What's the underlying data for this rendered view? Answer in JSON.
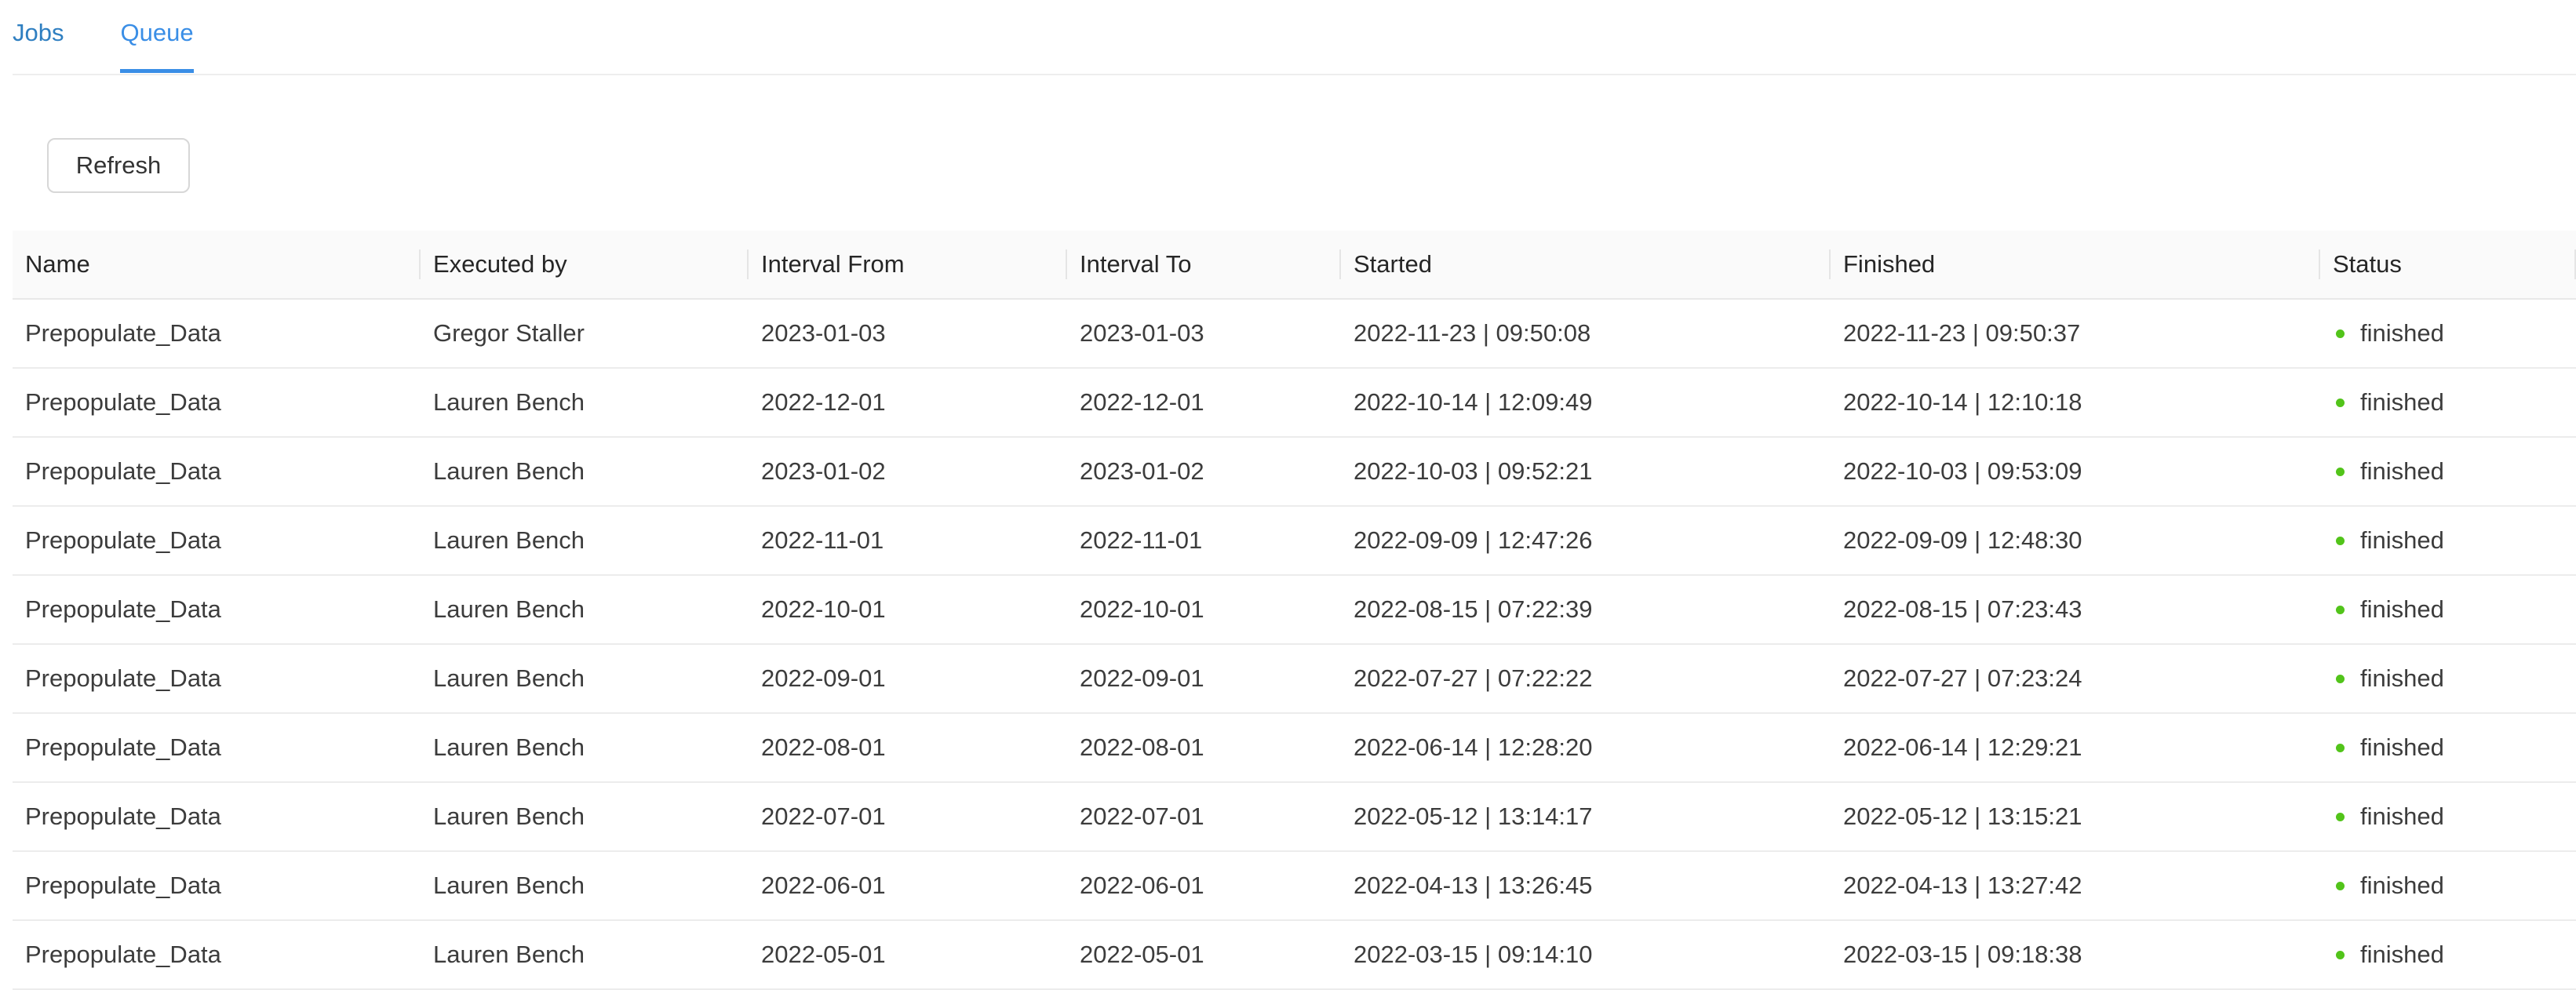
{
  "tabs": [
    {
      "label": "Jobs",
      "active": false
    },
    {
      "label": "Queue",
      "active": true
    }
  ],
  "toolbar": {
    "refresh_label": "Refresh"
  },
  "colors": {
    "accent": "#3a8ee6",
    "status_finished": "#52c41a"
  },
  "table": {
    "columns": [
      "Name",
      "Executed by",
      "Interval From",
      "Interval To",
      "Started",
      "Finished",
      "Status"
    ],
    "rows": [
      {
        "name": "Prepopulate_Data",
        "executed_by": "Gregor Staller",
        "interval_from": "2023-01-03",
        "interval_to": "2023-01-03",
        "started": "2022-11-23 | 09:50:08",
        "finished": "2022-11-23 | 09:50:37",
        "status": "finished"
      },
      {
        "name": "Prepopulate_Data",
        "executed_by": "Lauren Bench",
        "interval_from": "2022-12-01",
        "interval_to": "2022-12-01",
        "started": "2022-10-14 | 12:09:49",
        "finished": "2022-10-14 | 12:10:18",
        "status": "finished"
      },
      {
        "name": "Prepopulate_Data",
        "executed_by": "Lauren Bench",
        "interval_from": "2023-01-02",
        "interval_to": "2023-01-02",
        "started": "2022-10-03 | 09:52:21",
        "finished": "2022-10-03 | 09:53:09",
        "status": "finished"
      },
      {
        "name": "Prepopulate_Data",
        "executed_by": "Lauren Bench",
        "interval_from": "2022-11-01",
        "interval_to": "2022-11-01",
        "started": "2022-09-09 | 12:47:26",
        "finished": "2022-09-09 | 12:48:30",
        "status": "finished"
      },
      {
        "name": "Prepopulate_Data",
        "executed_by": "Lauren Bench",
        "interval_from": "2022-10-01",
        "interval_to": "2022-10-01",
        "started": "2022-08-15 | 07:22:39",
        "finished": "2022-08-15 | 07:23:43",
        "status": "finished"
      },
      {
        "name": "Prepopulate_Data",
        "executed_by": "Lauren Bench",
        "interval_from": "2022-09-01",
        "interval_to": "2022-09-01",
        "started": "2022-07-27 | 07:22:22",
        "finished": "2022-07-27 | 07:23:24",
        "status": "finished"
      },
      {
        "name": "Prepopulate_Data",
        "executed_by": "Lauren Bench",
        "interval_from": "2022-08-01",
        "interval_to": "2022-08-01",
        "started": "2022-06-14 | 12:28:20",
        "finished": "2022-06-14 | 12:29:21",
        "status": "finished"
      },
      {
        "name": "Prepopulate_Data",
        "executed_by": "Lauren Bench",
        "interval_from": "2022-07-01",
        "interval_to": "2022-07-01",
        "started": "2022-05-12 | 13:14:17",
        "finished": "2022-05-12 | 13:15:21",
        "status": "finished"
      },
      {
        "name": "Prepopulate_Data",
        "executed_by": "Lauren Bench",
        "interval_from": "2022-06-01",
        "interval_to": "2022-06-01",
        "started": "2022-04-13 | 13:26:45",
        "finished": "2022-04-13 | 13:27:42",
        "status": "finished"
      },
      {
        "name": "Prepopulate_Data",
        "executed_by": "Lauren Bench",
        "interval_from": "2022-05-01",
        "interval_to": "2022-05-01",
        "started": "2022-03-15 | 09:14:10",
        "finished": "2022-03-15 | 09:18:38",
        "status": "finished"
      }
    ]
  }
}
